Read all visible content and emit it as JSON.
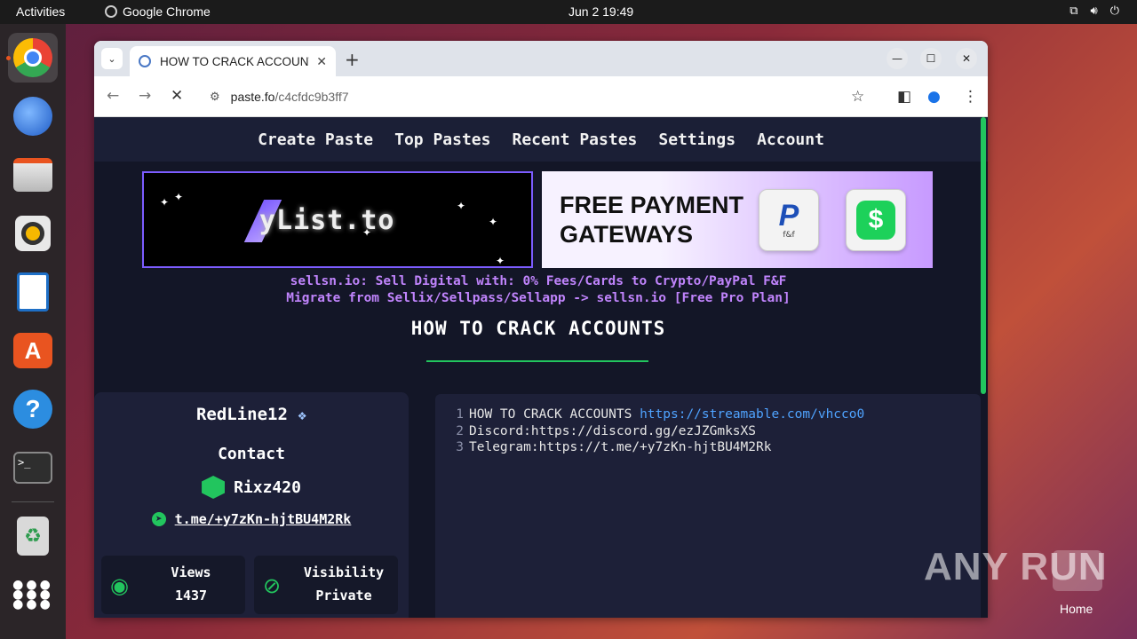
{
  "system": {
    "activities": "Activities",
    "app_name": "Google Chrome",
    "clock": "Jun 2  19:49",
    "tray_icons": [
      "network-icon",
      "volume-icon",
      "power-icon"
    ]
  },
  "dock": {
    "items": [
      "chrome-icon",
      "thunderbird-icon",
      "files-icon",
      "rhythmbox-icon",
      "writer-icon",
      "app-center-icon",
      "help-icon",
      "terminal-icon",
      "trash-icon",
      "app-grid-icon"
    ]
  },
  "browser": {
    "tab_title": "HOW TO CRACK ACCOUNTS",
    "url_host": "paste.fo",
    "url_path": "/c4cfdc9b3ff7"
  },
  "site": {
    "nav": [
      "Create Paste",
      "Top Pastes",
      "Recent Pastes",
      "Settings",
      "Account"
    ],
    "banner1_text": "yList.to",
    "banner2_text_line1": "FREE PAYMENT",
    "banner2_text_line2": "GATEWAYS",
    "paypal_sub": "f&f",
    "promo_line1": "sellsn.io: Sell Digital with: 0% Fees/Cards to Crypto/PayPal F&F",
    "promo_line2": "Migrate from Sellix/Sellpass/Sellapp -> sellsn.io [Free Pro Plan]",
    "paste_title": "HOW TO CRACK ACCOUNTS",
    "accent_color": "#22c55e"
  },
  "profile": {
    "username": "RedLine12",
    "contact_heading": "Contact",
    "contact_name": "Rixz420",
    "telegram": "t.me/+y7zKn-hjtBU4M2Rk",
    "views_label": "Views",
    "views_value": "1437",
    "visibility_label": "Visibility",
    "visibility_value": "Private"
  },
  "code_lines": [
    {
      "n": "1",
      "text": "HOW TO CRACK ACCOUNTS ",
      "link": "https://streamable.com/vhcco0"
    },
    {
      "n": "2",
      "text": "Discord:https://discord.gg/ezJZGmksXS",
      "link": ""
    },
    {
      "n": "3",
      "text": "Telegram:https://t.me/+y7zKn-hjtBU4M2Rk",
      "link": ""
    }
  ],
  "watermark": "ANY RUN",
  "desktop_home_label": "Home"
}
